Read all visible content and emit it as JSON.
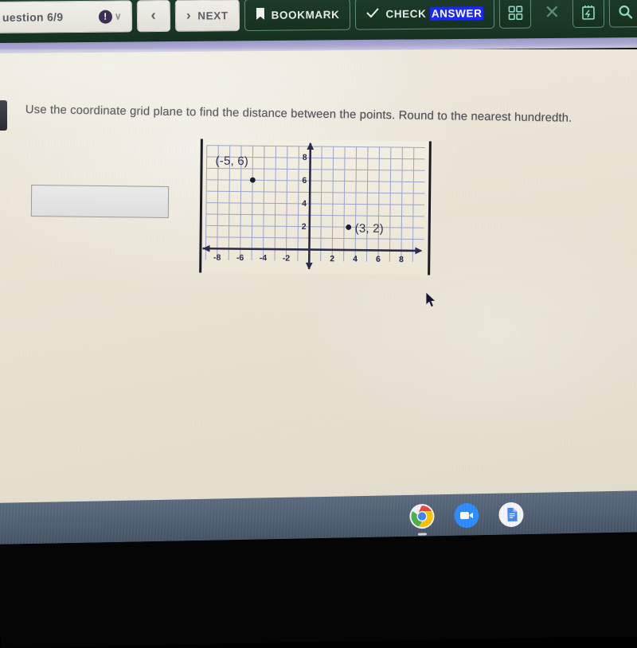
{
  "toolbar": {
    "question_tab": {
      "label": "uestion 6/9",
      "status_icon": "exclamation-icon",
      "chevron": "∨"
    },
    "back_button": {
      "glyph": "‹"
    },
    "next_button": {
      "glyph": "›",
      "label": "NEXT"
    },
    "bookmark_button": {
      "icon": "bookmark-icon",
      "label": "BOOKMARK"
    },
    "check_answer_button": {
      "icon": "check-icon",
      "label_plain": "CHECK ",
      "label_selected": "ANSWER"
    },
    "grid_button": {
      "icon": "grid-icon"
    },
    "close_button": {
      "icon": "close-icon",
      "glyph": "✕"
    },
    "notepad_button": {
      "icon": "notepad-icon"
    },
    "search_button": {
      "icon": "magnifier-icon"
    }
  },
  "content": {
    "question_text": "Use the coordinate grid plane to find the distance between the points.  Round to the nearest hundredth.",
    "answer_input": {
      "value": "",
      "placeholder": ""
    }
  },
  "chart_data": {
    "type": "scatter",
    "title": "",
    "xlabel": "",
    "ylabel": "",
    "xlim": [
      -9,
      9
    ],
    "ylim": [
      -1,
      9
    ],
    "grid": true,
    "xticks": [
      -8,
      -6,
      -4,
      -2,
      2,
      4,
      6,
      8
    ],
    "yticks": [
      2,
      4,
      6,
      8
    ],
    "xtick_labels": [
      "-8",
      "-6",
      "-4",
      "-2",
      "2",
      "4",
      "6",
      "8"
    ],
    "ytick_labels": [
      "2",
      "4",
      "6",
      "8"
    ],
    "points": [
      {
        "label": "(-5, 6)",
        "x": -5,
        "y": 6
      },
      {
        "label": "(3, 2)",
        "x": 3,
        "y": 2
      }
    ],
    "legend": null
  },
  "taskbar": {
    "items": [
      {
        "name": "chrome-icon"
      },
      {
        "name": "zoom-video-icon"
      },
      {
        "name": "google-docs-icon"
      }
    ]
  },
  "cursor": {
    "name": "mouse-pointer"
  }
}
